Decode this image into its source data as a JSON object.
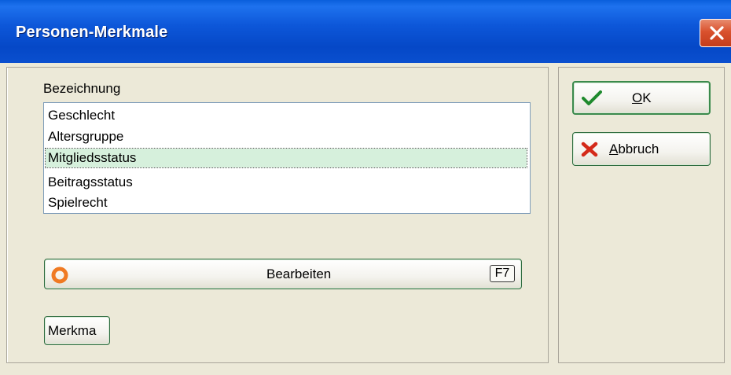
{
  "window": {
    "title": "Personen-Merkmale"
  },
  "list": {
    "label": "Bezeichnung",
    "items": [
      "Geschlecht",
      "Altersgruppe",
      "Mitgliedsstatus",
      "Beitragsstatus",
      "Spielrecht"
    ],
    "selected_index": 2
  },
  "buttons": {
    "ok": {
      "mnemonic": "O",
      "rest": "K"
    },
    "abbruch": {
      "mnemonic": "A",
      "rest": "bbruch"
    },
    "bearbeiten": {
      "label": "Bearbeiten",
      "shortcut": "F7"
    },
    "merkma": {
      "label": "Merkma"
    }
  },
  "icons": {
    "close": "close-x-icon",
    "ok": "checkmark-icon",
    "abbruch": "red-x-icon",
    "bearbeiten": "orange-ring-icon"
  },
  "colors": {
    "titlebar": "#0548c7",
    "dialog_bg": "#ece9d8",
    "selection": "#d6f0dc",
    "button_border": "#2d6b3e",
    "close_button": "#d9512d"
  }
}
